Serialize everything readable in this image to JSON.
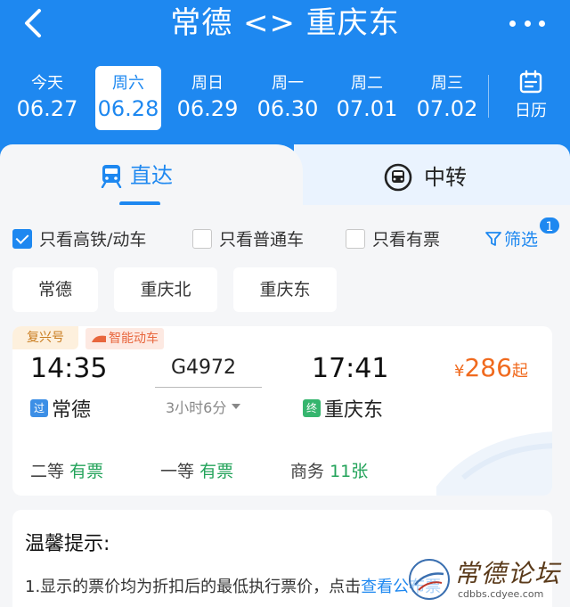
{
  "header": {
    "title": "常德 <> 重庆东",
    "back_icon": "chevron-left-icon",
    "more_icon": "more-dots-icon",
    "bg_color": "#1e88f0"
  },
  "dates": [
    {
      "weekday": "今天",
      "date": "06.27",
      "selected": false
    },
    {
      "weekday": "周六",
      "date": "06.28",
      "selected": true
    },
    {
      "weekday": "周日",
      "date": "06.29",
      "selected": false
    },
    {
      "weekday": "周一",
      "date": "06.30",
      "selected": false
    },
    {
      "weekday": "周二",
      "date": "07.01",
      "selected": false
    },
    {
      "weekday": "周三",
      "date": "07.02",
      "selected": false
    }
  ],
  "calendar": {
    "label": "日历",
    "icon": "calendar-icon"
  },
  "tabs": [
    {
      "label": "直达",
      "icon": "train-icon",
      "active": true
    },
    {
      "label": "中转",
      "icon": "transfer-train-icon",
      "active": false
    }
  ],
  "filters": {
    "options": [
      {
        "label": "只看高铁/动车",
        "checked": true
      },
      {
        "label": "只看普通车",
        "checked": false
      },
      {
        "label": "只看有票",
        "checked": false
      }
    ],
    "filter_label": "筛选",
    "filter_badge": "1"
  },
  "stations": [
    "常德",
    "重庆北",
    "重庆东"
  ],
  "train": {
    "tag_brand": "复兴号",
    "tag_smart": "智能动车",
    "depart_time": "14:35",
    "arrive_time": "17:41",
    "train_no": "G4972",
    "duration": "3小时6分",
    "from_mark": "过",
    "from_station": "常德",
    "to_mark": "终",
    "to_station": "重庆东",
    "price_symbol": "¥",
    "price": "286",
    "price_suffix": "起",
    "seats": [
      {
        "class": "二等",
        "status": "有票"
      },
      {
        "class": "一等",
        "status": "有票"
      },
      {
        "class": "商务",
        "status": "11张"
      }
    ]
  },
  "tips": {
    "title": "温馨提示:",
    "line1": "1.显示的票价均为折扣后的最低执行票价，点击",
    "link": "查看公布票"
  },
  "watermark": {
    "title": "常德论坛",
    "url": "cdbbs.cdyee.com"
  }
}
